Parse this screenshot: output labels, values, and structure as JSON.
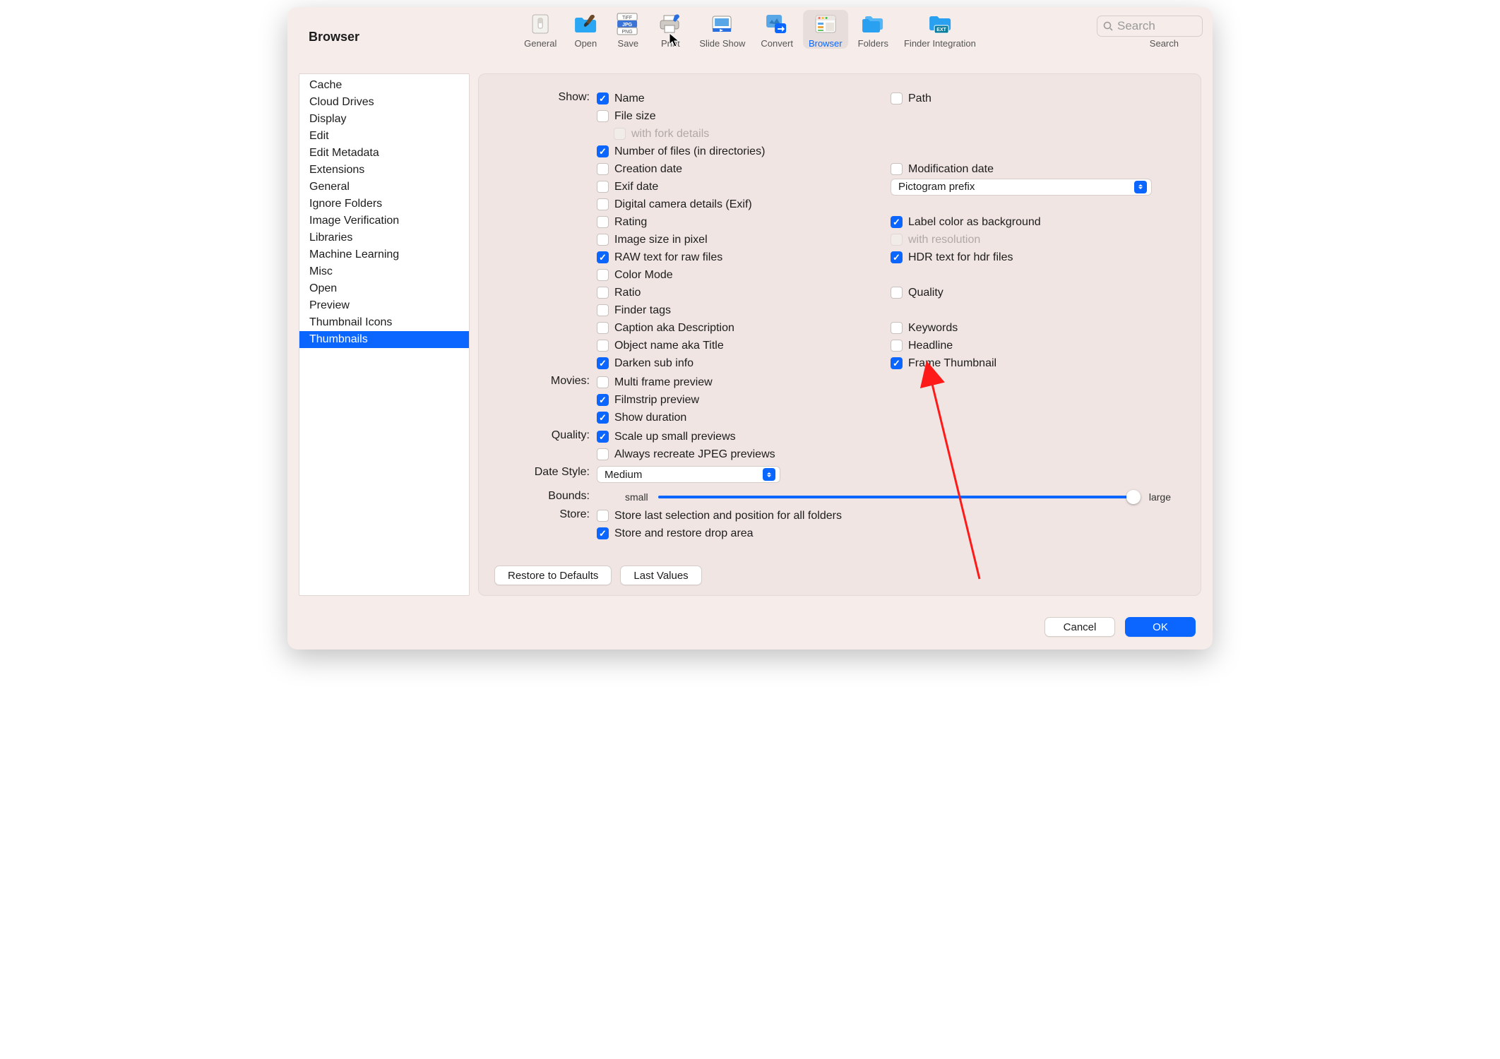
{
  "window": {
    "title": "Browser"
  },
  "toolbar": {
    "items": [
      {
        "label": "General"
      },
      {
        "label": "Open"
      },
      {
        "label": "Save"
      },
      {
        "label": "Print"
      },
      {
        "label": "Slide Show"
      },
      {
        "label": "Convert"
      },
      {
        "label": "Browser"
      },
      {
        "label": "Folders"
      },
      {
        "label": "Finder Integration"
      }
    ],
    "selected_index": 6,
    "search_placeholder": "Search",
    "search_caption": "Search"
  },
  "sidebar": {
    "items": [
      "Cache",
      "Cloud Drives",
      "Display",
      "Edit",
      "Edit Metadata",
      "Extensions",
      "General",
      "Ignore Folders",
      "Image Verification",
      "Libraries",
      "Machine Learning",
      "Misc",
      "Open",
      "Preview",
      "Thumbnail Icons",
      "Thumbnails"
    ],
    "selected_index": 15
  },
  "sections": {
    "show": "Show:",
    "movies": "Movies:",
    "quality": "Quality:",
    "date_style": "Date Style:",
    "bounds": "Bounds:",
    "store": "Store:"
  },
  "checkboxes": {
    "name": "Name",
    "path": "Path",
    "file_size": "File size",
    "fork": "with fork details",
    "num_files": "Number of files (in directories)",
    "creation_date": "Creation date",
    "modification_date": "Modification date",
    "exif_date": "Exif date",
    "digital_camera": "Digital camera details (Exif)",
    "rating": "Rating",
    "label_bg": "Label color as background",
    "image_size": "Image size in pixel",
    "with_res": "with resolution",
    "raw_text": "RAW text for raw files",
    "hdr_text": "HDR text for hdr files",
    "color_mode": "Color Mode",
    "ratio": "Ratio",
    "quality_cb": "Quality",
    "finder_tags": "Finder tags",
    "caption": "Caption aka Description",
    "keywords": "Keywords",
    "object_name": "Object name aka Title",
    "headline": "Headline",
    "darken": "Darken sub info",
    "frame_thumb": "Frame Thumbnail",
    "multi_frame": "Multi frame preview",
    "filmstrip": "Filmstrip preview",
    "show_duration": "Show duration",
    "scale_up": "Scale up small previews",
    "recreate_jpeg": "Always recreate JPEG previews",
    "store_sel": "Store last selection and position for all folders",
    "store_drop": "Store and restore drop area"
  },
  "selects": {
    "pictogram": "Pictogram prefix",
    "date_style_val": "Medium"
  },
  "slider": {
    "small": "small",
    "large": "large",
    "value": 100
  },
  "buttons": {
    "restore": "Restore to Defaults",
    "last": "Last Values",
    "cancel": "Cancel",
    "ok": "OK"
  }
}
